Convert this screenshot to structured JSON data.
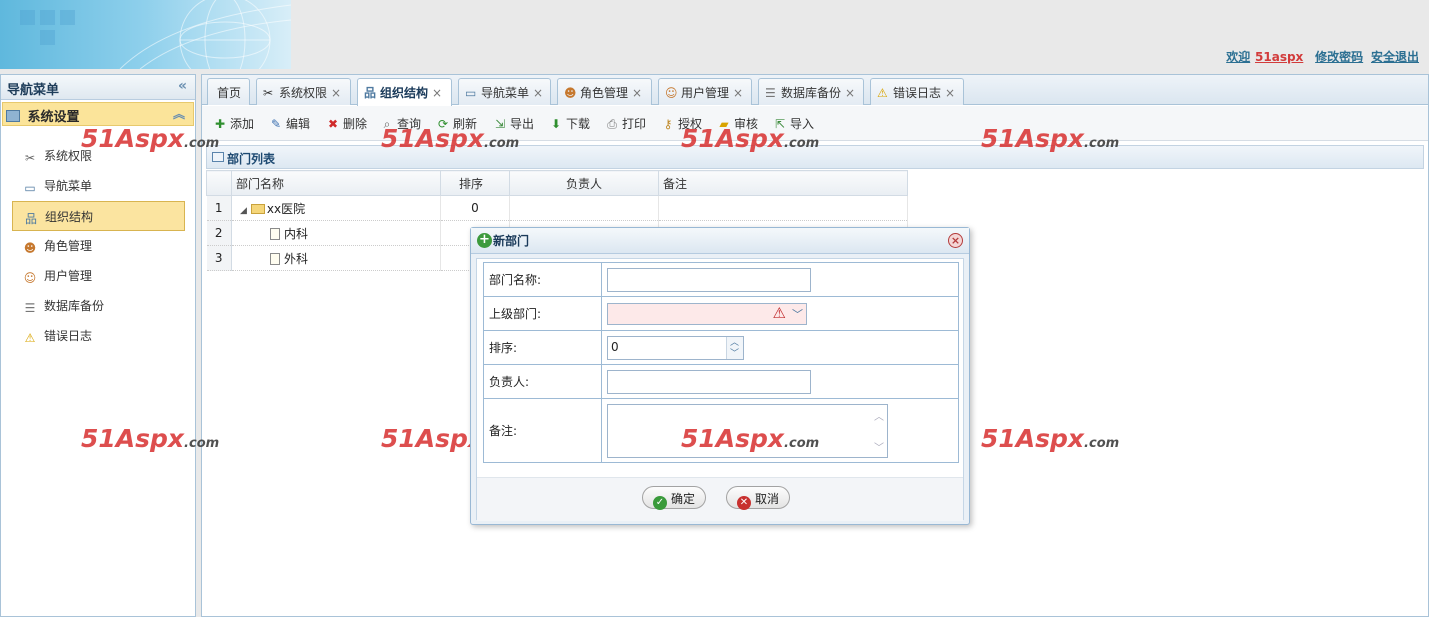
{
  "header": {
    "welcome_prefix": "欢迎",
    "username": "51aspx",
    "change_password": "修改密码",
    "logout": "安全退出"
  },
  "nav": {
    "title": "导航菜单",
    "collapse_icon": "double-chevron-left-icon",
    "group": "系统设置",
    "items": [
      {
        "label": "系统权限",
        "icon": "tools-icon"
      },
      {
        "label": "导航菜单",
        "icon": "window-icon"
      },
      {
        "label": "组织结构",
        "icon": "org-chart-icon",
        "active": true
      },
      {
        "label": "角色管理",
        "icon": "user-group-icon"
      },
      {
        "label": "用户管理",
        "icon": "users-icon"
      },
      {
        "label": "数据库备份",
        "icon": "database-icon"
      },
      {
        "label": "错误日志",
        "icon": "warning-icon"
      }
    ]
  },
  "tabs": [
    {
      "label": "首页"
    },
    {
      "label": "系统权限",
      "icon": "tools-icon"
    },
    {
      "label": "组织结构",
      "icon": "org-chart-icon",
      "active": true
    },
    {
      "label": "导航菜单",
      "icon": "window-icon"
    },
    {
      "label": "角色管理",
      "icon": "user-group-icon"
    },
    {
      "label": "用户管理",
      "icon": "users-icon"
    },
    {
      "label": "数据库备份",
      "icon": "database-icon"
    },
    {
      "label": "错误日志",
      "icon": "warning-icon"
    }
  ],
  "toolbar": {
    "add": "添加",
    "edit": "编辑",
    "delete": "删除",
    "query": "查询",
    "refresh": "刷新",
    "export": "导出",
    "download": "下载",
    "print": "打印",
    "authorize": "授权",
    "audit": "审核",
    "import": "导入"
  },
  "panel": {
    "title": "部门列表"
  },
  "grid": {
    "columns": [
      "部门名称",
      "排序",
      "负责人",
      "备注"
    ],
    "rows": [
      {
        "num": "1",
        "name": "xx医院",
        "sort": "0",
        "manager": "",
        "note": ""
      },
      {
        "num": "2",
        "name": "内科",
        "sort": "",
        "manager": "",
        "note": ""
      },
      {
        "num": "3",
        "name": "外科",
        "sort": "",
        "manager": "",
        "note": ""
      }
    ]
  },
  "dialog": {
    "title": "新部门",
    "fields": {
      "name_label": "部门名称:",
      "parent_label": "上级部门:",
      "sort_label": "排序:",
      "sort_value": "0",
      "manager_label": "负责人:",
      "note_label": "备注:"
    },
    "ok": "确定",
    "cancel": "取消"
  },
  "watermark": {
    "main": "51Aspx",
    "suffix": ".com"
  },
  "colors": {
    "accent": "#2b6f92",
    "active_bg": "#fbe4a0",
    "border": "#a9c3d8",
    "watermark": "#d83030"
  }
}
